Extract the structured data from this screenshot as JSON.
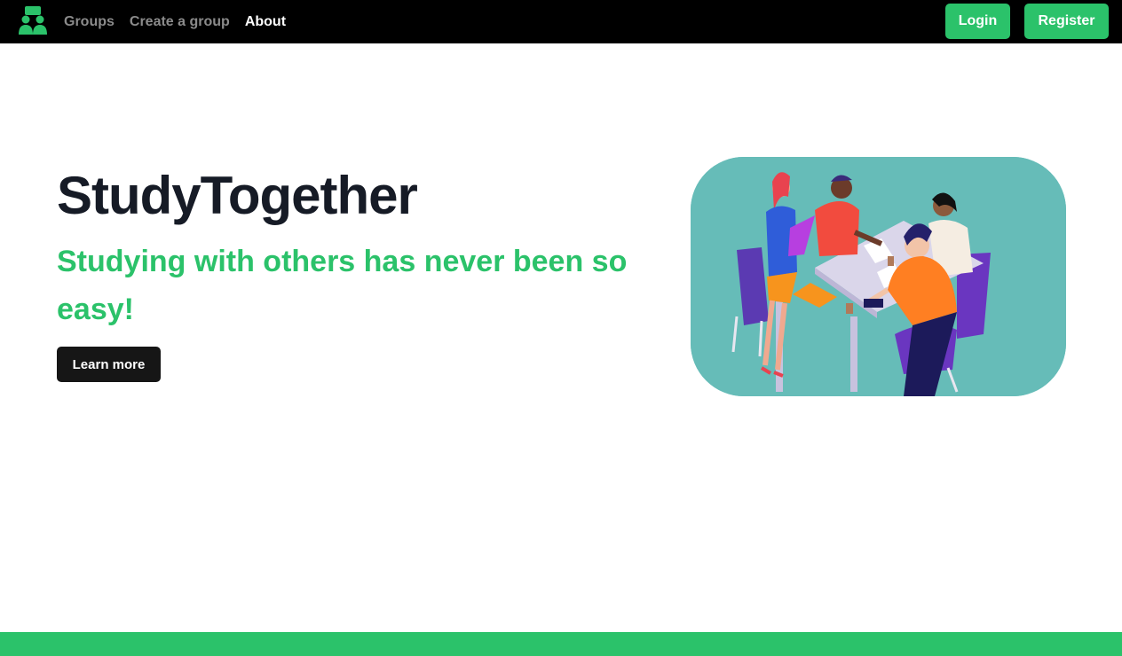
{
  "nav": {
    "logo_icon": "group-people-icon",
    "links": [
      {
        "label": "Groups",
        "active": false
      },
      {
        "label": "Create a group",
        "active": false
      },
      {
        "label": "About",
        "active": true
      }
    ],
    "login_label": "Login",
    "register_label": "Register"
  },
  "hero": {
    "title": "StudyTogether",
    "subtitle": "Studying with others has never been so easy!",
    "cta_label": "Learn more",
    "illustration": "people-studying-at-table-illustration"
  },
  "colors": {
    "brand_green": "#2bc26a",
    "navbar": "#000000",
    "title_text": "#161b26",
    "illustration_bg": "#66bcb8"
  }
}
